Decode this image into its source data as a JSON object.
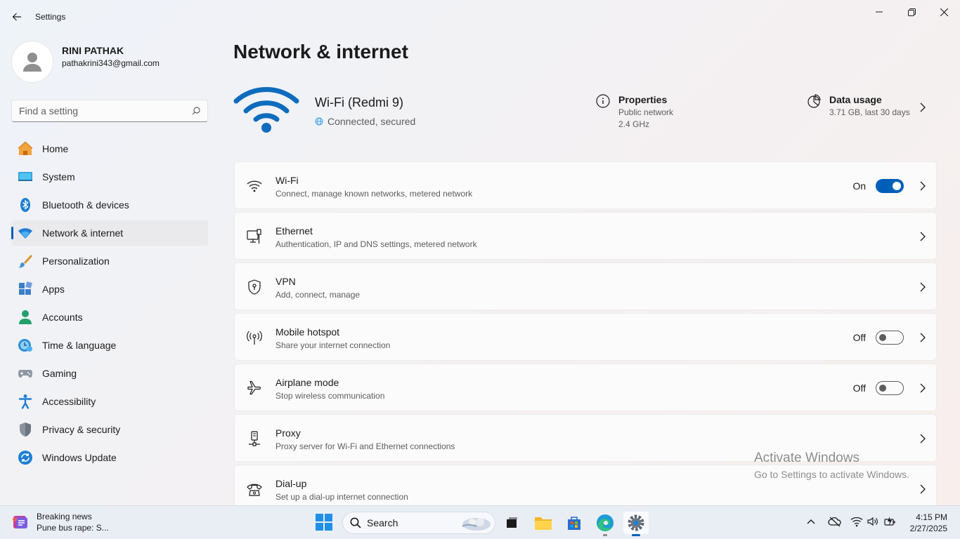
{
  "window": {
    "title": "Settings"
  },
  "profile": {
    "name": "RINI PATHAK",
    "email": "pathakrini343@gmail.com"
  },
  "search": {
    "placeholder": "Find a setting"
  },
  "nav": {
    "items": [
      {
        "label": "Home",
        "icon": "home-icon"
      },
      {
        "label": "System",
        "icon": "system-icon"
      },
      {
        "label": "Bluetooth & devices",
        "icon": "bluetooth-icon"
      },
      {
        "label": "Network & internet",
        "icon": "network-icon",
        "active": true
      },
      {
        "label": "Personalization",
        "icon": "brush-icon"
      },
      {
        "label": "Apps",
        "icon": "apps-icon"
      },
      {
        "label": "Accounts",
        "icon": "accounts-icon"
      },
      {
        "label": "Time & language",
        "icon": "clock-globe-icon"
      },
      {
        "label": "Gaming",
        "icon": "controller-icon"
      },
      {
        "label": "Accessibility",
        "icon": "accessibility-icon"
      },
      {
        "label": "Privacy & security",
        "icon": "shield-icon"
      },
      {
        "label": "Windows Update",
        "icon": "update-icon"
      }
    ]
  },
  "page": {
    "title": "Network & internet"
  },
  "hero": {
    "network_name": "Wi-Fi (Redmi 9)",
    "status": "Connected, secured",
    "properties_title": "Properties",
    "properties_line1": "Public network",
    "properties_line2": "2.4 GHz",
    "usage_title": "Data usage",
    "usage_sub": "3.71 GB, last 30 days"
  },
  "cards": [
    {
      "title": "Wi-Fi",
      "sub": "Connect, manage known networks, metered network",
      "toggle": "On"
    },
    {
      "title": "Ethernet",
      "sub": "Authentication, IP and DNS settings, metered network"
    },
    {
      "title": "VPN",
      "sub": "Add, connect, manage"
    },
    {
      "title": "Mobile hotspot",
      "sub": "Share your internet connection",
      "toggle": "Off"
    },
    {
      "title": "Airplane mode",
      "sub": "Stop wireless communication",
      "toggle": "Off"
    },
    {
      "title": "Proxy",
      "sub": "Proxy server for Wi-Fi and Ethernet connections"
    },
    {
      "title": "Dial-up",
      "sub": "Set up a dial-up internet connection"
    }
  ],
  "watermark": {
    "title": "Activate Windows",
    "sub": "Go to Settings to activate Windows."
  },
  "taskbar": {
    "news_title": "Breaking news",
    "news_sub": "Pune bus rape: S...",
    "search_label": "Search",
    "time": "4:15 PM",
    "date": "2/27/2025"
  },
  "colors": {
    "accent": "#005fb8",
    "wifi_hero": "#0f6cbd"
  }
}
